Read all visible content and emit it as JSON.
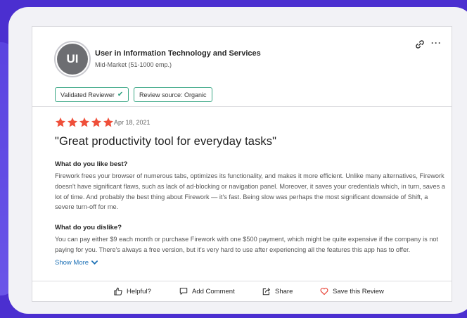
{
  "user": {
    "initials": "UI",
    "title": "User in Information Technology and Services",
    "segment": "Mid-Market (51-1000 emp.)"
  },
  "badges": {
    "validated": "Validated Reviewer",
    "source": "Review source: Organic"
  },
  "review": {
    "rating": 5,
    "date": "Apr 18, 2021",
    "title": "\"Great productivity tool for everyday tasks\"",
    "like_label": "What do you like best?",
    "like_text": "Firework frees your browser of numerous tabs, optimizes its functionality, and makes it more efficient. Unlike many alternatives, Firework doesn't have significant flaws, such as lack of ad-blocking or navigation panel. Moreover, it saves your credentials which, in turn, saves a lot of time. And probably the best thing about Firework — it's fast. Being slow was perhaps the most significant downside of Shift, a severe turn-off for me.",
    "dislike_label": "What do you dislike?",
    "dislike_text": "You can pay either $9 each month or purchase Firework with one $500 payment, which might be quite expensive if the company is not paying for you. There's always a free version, but it's very hard to use after experiencing all the features this app has to offer.",
    "show_more": "Show More"
  },
  "actions": {
    "helpful": "Helpful?",
    "comment": "Add Comment",
    "share": "Share",
    "save": "Save this Review"
  },
  "colors": {
    "star": "#ef4f3a",
    "badge_border": "#3aa785",
    "link": "#1a6fb5",
    "heart": "#e8473b",
    "background": "#4b2fd0"
  }
}
